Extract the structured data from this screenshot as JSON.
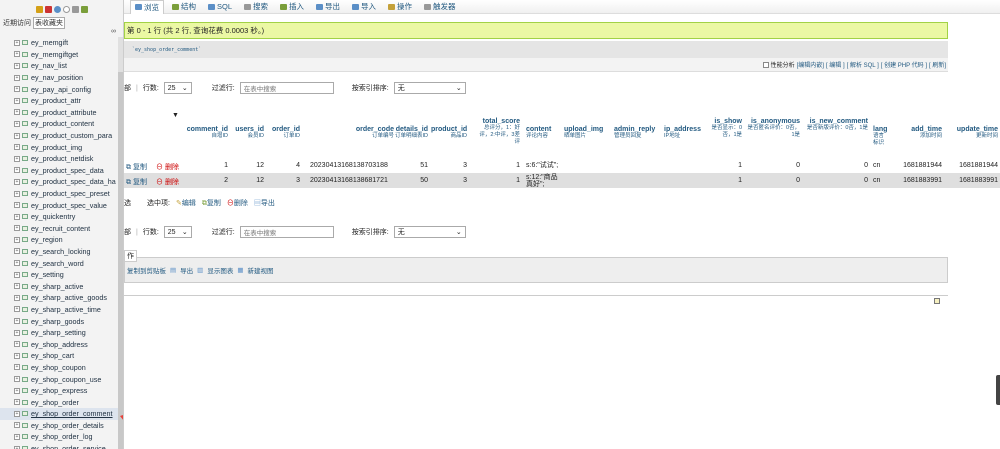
{
  "sidebar": {
    "recent_label": "近期访问",
    "favorites_label": "表收藏夹",
    "tables": [
      "ey_memgift",
      "ey_memgiftget",
      "ey_nav_list",
      "ey_nav_position",
      "ey_pay_api_config",
      "ey_product_attr",
      "ey_product_attribute",
      "ey_product_content",
      "ey_product_custom_para",
      "ey_product_img",
      "ey_product_netdisk",
      "ey_product_spec_data",
      "ey_product_spec_data_ha",
      "ey_product_spec_preset",
      "ey_product_spec_value",
      "ey_quickentry",
      "ey_recruit_content",
      "ey_region",
      "ey_search_locking",
      "ey_search_word",
      "ey_setting",
      "ey_sharp_active",
      "ey_sharp_active_goods",
      "ey_sharp_active_time",
      "ey_sharp_goods",
      "ey_sharp_setting",
      "ey_shop_address",
      "ey_shop_cart",
      "ey_shop_coupon",
      "ey_shop_coupon_use",
      "ey_shop_express",
      "ey_shop_order",
      "ey_shop_order_comment",
      "ey_shop_order_details",
      "ey_shop_order_log",
      "ey_shop_order_service"
    ],
    "selected_table": "ey_shop_order_comment"
  },
  "tabs": [
    {
      "label": "浏览",
      "color": "#5b8fc7"
    },
    {
      "label": "结构",
      "color": "#7a9e3a"
    },
    {
      "label": "SQL",
      "color": "#5b8fc7"
    },
    {
      "label": "搜索",
      "color": "#999"
    },
    {
      "label": "插入",
      "color": "#7a9e3a"
    },
    {
      "label": "导出",
      "color": "#5b8fc7"
    },
    {
      "label": "导入",
      "color": "#5b8fc7"
    },
    {
      "label": "操作",
      "color": "#c4a13a"
    },
    {
      "label": "触发器",
      "color": "#999"
    }
  ],
  "success_message": "第 0 - 1 行 (共 2 行, 查询花费 0.0003 秒。)",
  "sql_query": "`ey_shop_order_comment`",
  "sql_links": {
    "profiling": "性能分析",
    "inline_edit": "[编辑内嵌]",
    "edit": "[ 编辑 ]",
    "explain": "[ 解析 SQL ]",
    "create_php": "[ 创建 PHP 代码 ]",
    "refresh": "[ 刷新]"
  },
  "nav": {
    "all_label": "部",
    "rows_label": "行数:",
    "rows_value": "25",
    "filter_label": "过滤行:",
    "filter_placeholder": "在表中搜索",
    "sort_label": "按索引排序:",
    "sort_value": "无"
  },
  "columns": [
    {
      "name": "comment_id",
      "desc": "自增ID"
    },
    {
      "name": "users_id",
      "desc": "会员ID"
    },
    {
      "name": "order_id",
      "desc": "订单ID"
    },
    {
      "name": "order_code",
      "desc": "订单编号"
    },
    {
      "name": "details_id",
      "desc": "订单明细表ID"
    },
    {
      "name": "product_id",
      "desc": "商品ID"
    },
    {
      "name": "total_score",
      "desc": "总评分，1：好评，2:中评，3差评"
    },
    {
      "name": "content",
      "desc": "评论内容"
    },
    {
      "name": "upload_img",
      "desc": "晒单图片"
    },
    {
      "name": "admin_reply",
      "desc": "管理员回复"
    },
    {
      "name": "ip_address",
      "desc": "IP地址"
    },
    {
      "name": "is_show",
      "desc": "是否显示：0否，1是"
    },
    {
      "name": "is_anonymous",
      "desc": "是否匿名评价：0否，1是"
    },
    {
      "name": "is_new_comment",
      "desc": "是否新版评价：0否，1是"
    },
    {
      "name": "lang",
      "desc": "语言标识"
    },
    {
      "name": "add_time",
      "desc": "添加时间"
    },
    {
      "name": "update_time",
      "desc": "更新时间"
    }
  ],
  "row_actions": {
    "copy": "复制",
    "delete": "删除"
  },
  "rows": [
    {
      "comment_id": "1",
      "users_id": "12",
      "order_id": "4",
      "order_code": "20230413168138703188",
      "details_id": "51",
      "product_id": "3",
      "total_score": "1",
      "content": "s:6:\"试试\";",
      "is_show": "1",
      "is_anonymous": "0",
      "is_new_comment": "0",
      "lang": "cn",
      "add_time": "1681881944",
      "update_time": "1681881944"
    },
    {
      "comment_id": "2",
      "users_id": "12",
      "order_id": "3",
      "order_code": "20230413168138681721",
      "details_id": "50",
      "product_id": "3",
      "total_score": "1",
      "content": "s:12:\"商品真好\";",
      "is_show": "1",
      "is_anonymous": "0",
      "is_new_comment": "0",
      "lang": "cn",
      "add_time": "1681883991",
      "update_time": "1681883991"
    }
  ],
  "bulk": {
    "select_all": "选",
    "selected_label": "选中项:",
    "edit": "编辑",
    "copy": "复制",
    "delete": "删除",
    "export": "导出"
  },
  "ops": {
    "title": "作",
    "copy_clipboard": "复制到剪贴板",
    "export": "导出",
    "show_chart": "显示图表",
    "new_view": "新建视图"
  },
  "colors": {
    "success_bg": "#ebf8a4",
    "link": "#235a81",
    "row_odd": "#fff",
    "row_even": "#dfdfdf",
    "delete": "#c00",
    "arrow": "#e8413a"
  }
}
